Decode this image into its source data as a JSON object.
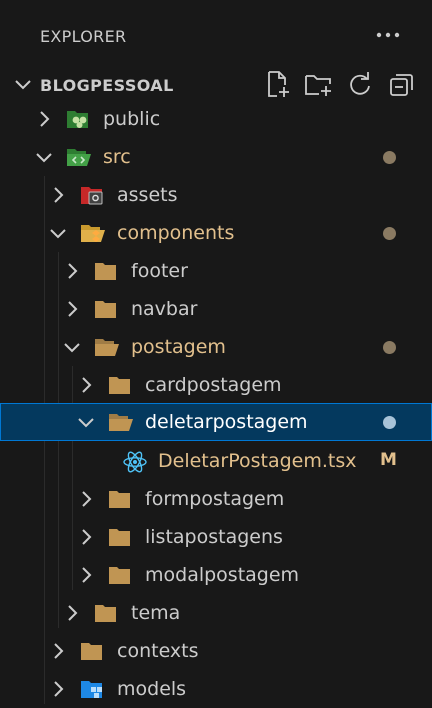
{
  "explorer": {
    "title": "EXPLORER",
    "more_icon": "ellipsis-icon"
  },
  "section": {
    "title": "BLOGPESSOAL",
    "actions": [
      "new-file-icon",
      "new-folder-icon",
      "refresh-icon",
      "collapse-all-icon"
    ]
  },
  "tree": [
    {
      "label": "public",
      "expanded": false,
      "icon": "folder-public-icon",
      "status": ""
    },
    {
      "label": "src",
      "expanded": true,
      "icon": "folder-src-icon",
      "status": "dot"
    },
    {
      "label": "assets",
      "expanded": false,
      "icon": "folder-assets-icon",
      "status": ""
    },
    {
      "label": "components",
      "expanded": true,
      "icon": "folder-components-icon",
      "status": "dot"
    },
    {
      "label": "footer",
      "expanded": false,
      "icon": "folder-icon",
      "status": ""
    },
    {
      "label": "navbar",
      "expanded": false,
      "icon": "folder-icon",
      "status": ""
    },
    {
      "label": "postagem",
      "expanded": true,
      "icon": "folder-open-icon",
      "status": "dot"
    },
    {
      "label": "cardpostagem",
      "expanded": false,
      "icon": "folder-icon",
      "status": ""
    },
    {
      "label": "deletarpostagem",
      "expanded": true,
      "icon": "folder-open-icon",
      "status": "dot",
      "selected": true
    },
    {
      "label": "DeletarPostagem.tsx",
      "file": true,
      "icon": "react-icon",
      "status": "M"
    },
    {
      "label": "formpostagem",
      "expanded": false,
      "icon": "folder-icon",
      "status": ""
    },
    {
      "label": "listapostagens",
      "expanded": false,
      "icon": "folder-icon",
      "status": ""
    },
    {
      "label": "modalpostagem",
      "expanded": false,
      "icon": "folder-icon",
      "status": ""
    },
    {
      "label": "tema",
      "expanded": false,
      "icon": "folder-icon",
      "status": ""
    },
    {
      "label": "contexts",
      "expanded": false,
      "icon": "folder-icon",
      "status": ""
    },
    {
      "label": "models",
      "expanded": false,
      "icon": "folder-models-icon",
      "status": ""
    }
  ],
  "colors": {
    "background": "#181818",
    "selection": "#04395e",
    "focus_border": "#0078d4",
    "modified": "#e2c08d",
    "text": "#cccccc"
  }
}
